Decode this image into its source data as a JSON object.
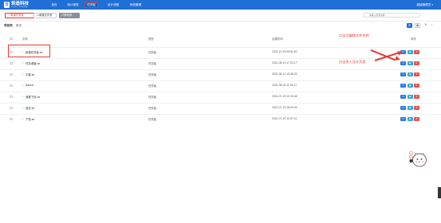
{
  "header": {
    "logo_text": "筑造科技",
    "logo_sub": "Zhuzao · Technology",
    "nav": [
      "首页",
      "统计报表",
      "任务板",
      "设计流程",
      "系统管理"
    ],
    "user": "超级管理员"
  },
  "toolbar": {
    "new_label": "新建任务板",
    "folder_label": "新建文件夹",
    "move_label": "移动到",
    "search_placeholder": "请输入搜索内容"
  },
  "breadcrumb": {
    "root": "项目表",
    "current": "测试"
  },
  "table": {
    "headers": {
      "name": "名称",
      "type": "类型",
      "time": "创建时间",
      "ops": "操作"
    },
    "rows": [
      {
        "name": "新建任务板.txt",
        "type": "任务板",
        "time": "2021-12-29 09:51:52"
      },
      {
        "name": "任务调度.txt",
        "type": "任务板",
        "time": "2021-08-13 17:23:17"
      },
      {
        "name": "平稳.txt",
        "type": "任务板",
        "time": "2021-08-13 15:46:23"
      },
      {
        "name": "test.txt",
        "type": "任务板",
        "time": "2021-08-09 11:26:17"
      },
      {
        "name": "我要下班.txt",
        "type": "任务板",
        "time": "2021-07-23 10:15:48"
      },
      {
        "name": "我也.txt",
        "type": "任务板",
        "time": "2021-07-23 18:00:34"
      },
      {
        "name": "下班.txt",
        "type": "任务板",
        "time": "2021-07-20 14:57:01"
      }
    ],
    "op_icons": [
      "edit-icon",
      "design-icon",
      "delete-icon"
    ]
  },
  "annotations": {
    "edit_hint": "点击可编辑文件名称",
    "design_hint": "点击进入设计页面"
  },
  "colors": {
    "primary": "#1f6fd6",
    "highlight": "#e53935",
    "edit": "#2b7be4",
    "view": "#38a3d9",
    "delete": "#e5534b"
  }
}
